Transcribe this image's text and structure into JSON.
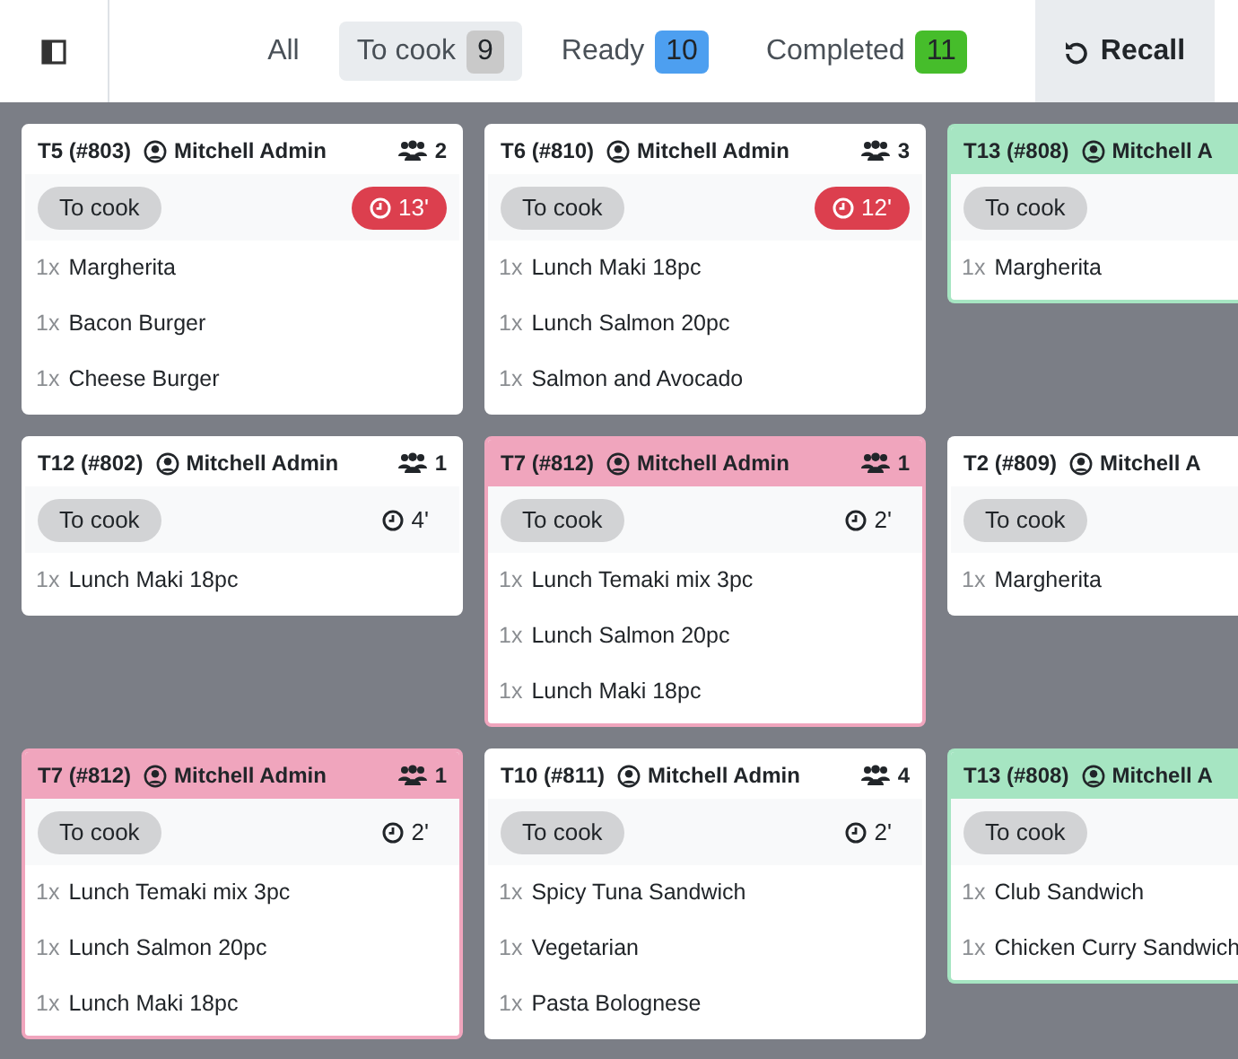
{
  "tabs": [
    {
      "label": "All",
      "selected": false
    },
    {
      "label": "To cook",
      "count": "9",
      "selected": true,
      "color": "#c9c9c9"
    },
    {
      "label": "Ready",
      "count": "10",
      "selected": false,
      "color": "#4d9ff0"
    },
    {
      "label": "Completed",
      "count": "11",
      "selected": false,
      "color": "#46bd2b"
    }
  ],
  "recall_button": {
    "label": "Recall"
  },
  "orders": [
    {
      "table": "T5 (#803)",
      "waiter": "Mitchell Admin",
      "guests": "2",
      "status": "To cook",
      "timer": "13'",
      "late": true,
      "lines": [
        {
          "qty": "1x",
          "name": "Margherita"
        },
        {
          "qty": "1x",
          "name": "Bacon Burger"
        },
        {
          "qty": "1x",
          "name": "Cheese Burger"
        }
      ]
    },
    {
      "table": "T6 (#810)",
      "waiter": "Mitchell Admin",
      "guests": "3",
      "status": "To cook",
      "timer": "12'",
      "late": true,
      "lines": [
        {
          "qty": "1x",
          "name": "Lunch Maki 18pc"
        },
        {
          "qty": "1x",
          "name": "Lunch Salmon 20pc"
        },
        {
          "qty": "1x",
          "name": "Salmon and Avocado"
        }
      ]
    },
    {
      "table": "T13 (#808)",
      "waiter": "Mitchell A",
      "status": "To cook",
      "color": "#a6e5c2",
      "lines": [
        {
          "qty": "1x",
          "name": "Margherita"
        }
      ]
    },
    {
      "table": "T12 (#802)",
      "waiter": "Mitchell Admin",
      "guests": "1",
      "status": "To cook",
      "timer": "4'",
      "late": false,
      "lines": [
        {
          "qty": "1x",
          "name": "Lunch Maki 18pc"
        }
      ]
    },
    {
      "table": "T7 (#812)",
      "waiter": "Mitchell Admin",
      "guests": "1",
      "status": "To cook",
      "timer": "2'",
      "late": false,
      "color": "#f0a5bd",
      "lines": [
        {
          "qty": "1x",
          "name": "Lunch Temaki mix 3pc"
        },
        {
          "qty": "1x",
          "name": "Lunch Salmon 20pc"
        },
        {
          "qty": "1x",
          "name": "Lunch Maki 18pc"
        }
      ]
    },
    {
      "table": "T2 (#809)",
      "waiter": "Mitchell A",
      "status": "To cook",
      "lines": [
        {
          "qty": "1x",
          "name": "Margherita"
        }
      ]
    },
    {
      "table": "T7 (#812)",
      "waiter": "Mitchell Admin",
      "guests": "1",
      "status": "To cook",
      "timer": "2'",
      "late": false,
      "color": "#f0a5bd",
      "lines": [
        {
          "qty": "1x",
          "name": "Lunch Temaki mix 3pc"
        },
        {
          "qty": "1x",
          "name": "Lunch Salmon 20pc"
        },
        {
          "qty": "1x",
          "name": "Lunch Maki 18pc"
        }
      ]
    },
    {
      "table": "T10 (#811)",
      "waiter": "Mitchell Admin",
      "guests": "4",
      "status": "To cook",
      "timer": "2'",
      "late": false,
      "lines": [
        {
          "qty": "1x",
          "name": "Spicy Tuna Sandwich"
        },
        {
          "qty": "1x",
          "name": "Vegetarian"
        },
        {
          "qty": "1x",
          "name": "Pasta Bolognese"
        }
      ]
    },
    {
      "table": "T13 (#808)",
      "waiter": "Mitchell A",
      "status": "To cook",
      "color": "#a6e5c2",
      "lines": [
        {
          "qty": "1x",
          "name": "Club Sandwich"
        },
        {
          "qty": "1x",
          "name": "Chicken Curry Sandwich"
        }
      ]
    }
  ]
}
